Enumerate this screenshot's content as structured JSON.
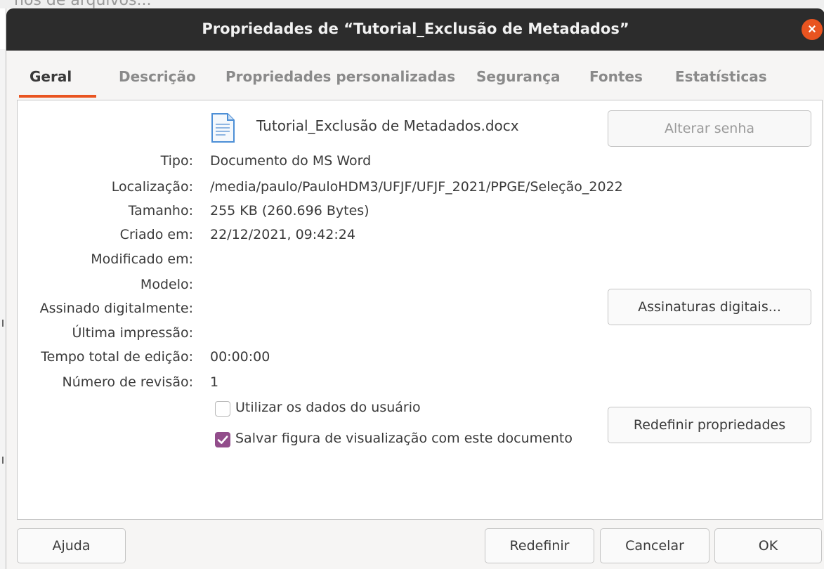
{
  "background": {
    "partial_text": "nos de arquivos..."
  },
  "window": {
    "title": "Propriedades de “Tutorial_Exclusão de Metadados”",
    "close_glyph": "×",
    "accent": "#e95420"
  },
  "tabs": [
    {
      "label": "Geral",
      "active": true
    },
    {
      "label": "Descrição",
      "active": false
    },
    {
      "label": "Propriedades personalizadas",
      "active": false
    },
    {
      "label": "Segurança",
      "active": false
    },
    {
      "label": "Fontes",
      "active": false
    },
    {
      "label": "Estatísticas",
      "active": false
    }
  ],
  "general": {
    "filename": "Tutorial_Exclusão de Metadados.docx",
    "file_icon": "document-icon",
    "change_password_label": "Alterar senha",
    "fields": [
      {
        "label": "Tipo:",
        "value": "Documento do MS Word"
      },
      {
        "label": "Localização:",
        "value": "/media/paulo/PauloHDM3/UFJF/UFJF_2021/PPGE/Seleção_2022"
      },
      {
        "label": "Tamanho:",
        "value": "255 KB (260.696 Bytes)"
      },
      {
        "label": "Criado em:",
        "value": "22/12/2021, 09:42:24"
      },
      {
        "label": "Modificado em:",
        "value": ""
      },
      {
        "label": "Modelo:",
        "value": ""
      },
      {
        "label": "Assinado digitalmente:",
        "value": ""
      },
      {
        "label": "Última impressão:",
        "value": ""
      },
      {
        "label": "Tempo total de edição:",
        "value": "00:00:00"
      },
      {
        "label": "Número de revisão:",
        "value": "1"
      }
    ],
    "digital_signatures_label": "Assinaturas digitais...",
    "use_user_data_label": "Utilizar os dados do usuário",
    "use_user_data_checked": false,
    "save_preview_label": "Salvar figura de visualização com este documento",
    "save_preview_checked": true,
    "check_color": "#924d8b",
    "reset_properties_label": "Redefinir propriedades"
  },
  "footer": {
    "help_label": "Ajuda",
    "reset_label": "Redefinir",
    "cancel_label": "Cancelar",
    "ok_label": "OK"
  }
}
